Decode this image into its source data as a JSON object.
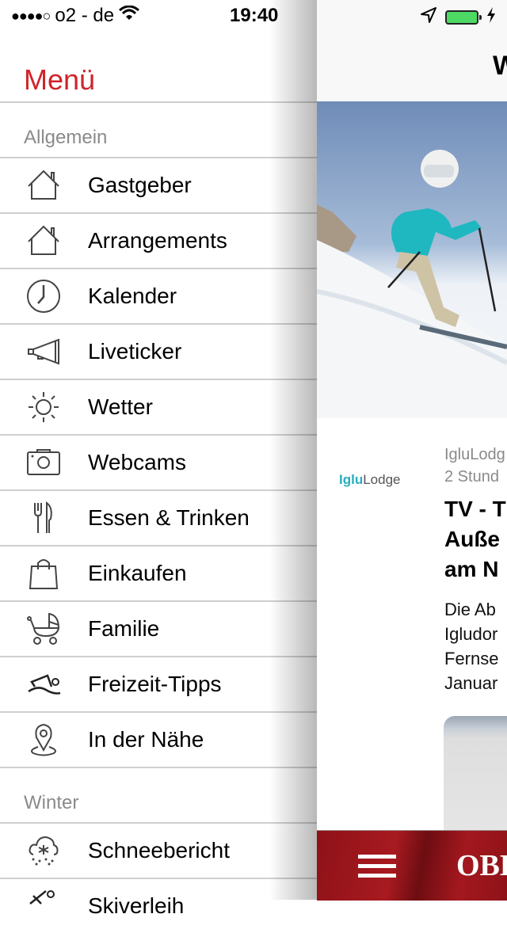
{
  "status_bar": {
    "signal": "●●●●○",
    "carrier": "o2 - de",
    "time": "19:40",
    "icons": [
      "wifi-icon",
      "location-arrow-icon",
      "battery-icon",
      "charging-bolt-icon"
    ]
  },
  "menu": {
    "title": "Menü",
    "sections": [
      {
        "label": "Allgemein",
        "items": [
          {
            "label": "Gastgeber",
            "icon": "house-icon"
          },
          {
            "label": "Arrangements",
            "icon": "house-icon"
          },
          {
            "label": "Kalender",
            "icon": "clock-icon"
          },
          {
            "label": "Liveticker",
            "icon": "megaphone-icon"
          },
          {
            "label": "Wetter",
            "icon": "sun-icon"
          },
          {
            "label": "Webcams",
            "icon": "camera-icon"
          },
          {
            "label": "Essen & Trinken",
            "icon": "fork-knife-icon"
          },
          {
            "label": "Einkaufen",
            "icon": "shopping-bag-icon"
          },
          {
            "label": "Familie",
            "icon": "stroller-icon"
          },
          {
            "label": "Freizeit-Tipps",
            "icon": "swimmer-icon"
          },
          {
            "label": "In der Nähe",
            "icon": "location-pin-icon"
          }
        ]
      },
      {
        "label": "Winter",
        "items": [
          {
            "label": "Schneebericht",
            "icon": "snow-cloud-icon"
          },
          {
            "label": "Skiverleih",
            "icon": "skier-icon"
          }
        ]
      }
    ]
  },
  "content": {
    "nav_title": "W",
    "article": {
      "source_logo_bold": "Iglu",
      "source_logo_rest": "Lodge",
      "source": "IgluLodg",
      "time": "2 Stund",
      "headline_lines": [
        "TV - T",
        "Auße",
        "am N"
      ],
      "teaser_lines": [
        "Die Ab",
        "Igludor",
        "Fernse",
        "Januar"
      ]
    },
    "bottom_bar": {
      "brand": "OBE",
      "menu_icon": "hamburger-menu-icon"
    }
  }
}
